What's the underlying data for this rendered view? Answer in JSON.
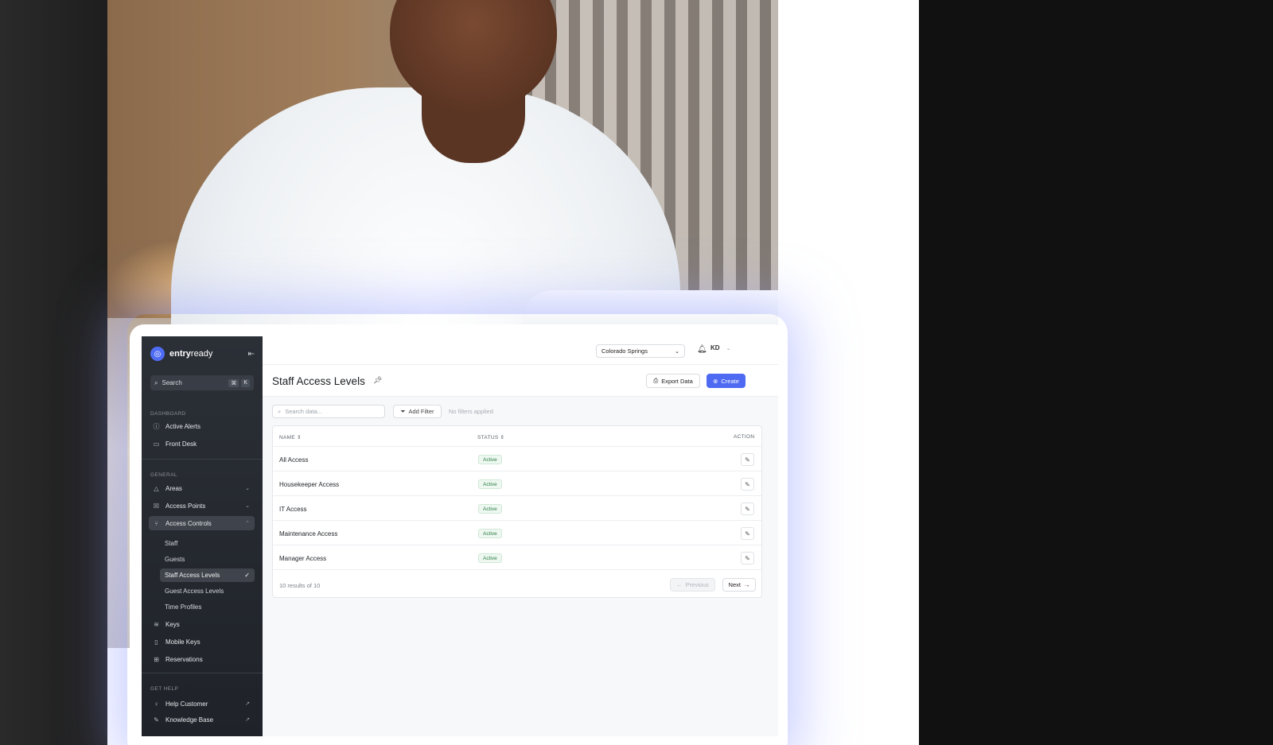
{
  "app": {
    "brand_bold": "entry",
    "brand_rest": "ready",
    "logo_icon": "entryready-logo-icon"
  },
  "sidebar": {
    "search_label": "Search",
    "search_shortcut": [
      "⌘",
      "K"
    ],
    "sections": {
      "dashboard": "DASHBOARD",
      "general": "GENERAL",
      "help": "GET HELP"
    },
    "dashboard_items": [
      {
        "label": "Active Alerts",
        "icon": "alert-circle-icon"
      },
      {
        "label": "Front Desk",
        "icon": "monitor-icon"
      }
    ],
    "general_items": [
      {
        "label": "Areas",
        "icon": "triangle-icon"
      },
      {
        "label": "Access Points",
        "icon": "door-icon"
      },
      {
        "label": "Access Controls",
        "icon": "branch-icon"
      }
    ],
    "access_controls_sub": [
      {
        "label": "Staff"
      },
      {
        "label": "Guests"
      },
      {
        "label": "Staff Access Levels"
      },
      {
        "label": "Guest Access Levels"
      },
      {
        "label": "Time Profiles"
      }
    ],
    "other_items": [
      {
        "label": "Keys",
        "icon": "layers-icon"
      },
      {
        "label": "Mobile Keys",
        "icon": "phone-icon"
      },
      {
        "label": "Reservations",
        "icon": "grid-icon"
      }
    ],
    "help_items": [
      {
        "label": "Help Customer",
        "icon": "lightbulb-icon"
      },
      {
        "label": "Knowledge Base",
        "icon": "book-icon"
      }
    ]
  },
  "topbar": {
    "location": "Colorado Springs",
    "user_initials": "KD"
  },
  "page": {
    "title": "Staff Access Levels",
    "export_label": "Export Data",
    "create_label": "Create"
  },
  "filters": {
    "search_placeholder": "Search data...",
    "add_filter_label": "Add Filter",
    "status_text": "No filters applied"
  },
  "table": {
    "columns": [
      "NAME",
      "STATUS",
      "ACTION"
    ],
    "rows": [
      {
        "name": "All Access",
        "status": "Active"
      },
      {
        "name": "Housekeeper Access",
        "status": "Active"
      },
      {
        "name": "IT Access",
        "status": "Active"
      },
      {
        "name": "Maintenance Access",
        "status": "Active"
      },
      {
        "name": "Manager Access",
        "status": "Active"
      }
    ],
    "results_text": "10 results of 10",
    "prev_label": "Previous",
    "next_label": "Next"
  },
  "colors": {
    "accent": "#4e6af2",
    "sidebar_bg": "#2b2f36",
    "status_active": "#2e7d45"
  }
}
